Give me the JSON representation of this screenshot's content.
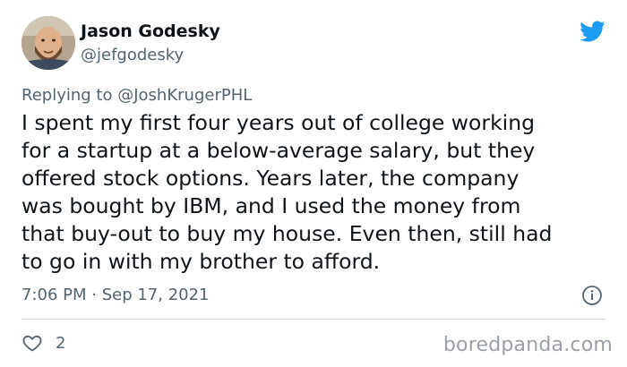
{
  "tweet": {
    "author_name": "Jason Godesky",
    "author_handle": "@jefgodesky",
    "replying_prefix": "Replying to",
    "replying_to": "@JoshKrugerPHL",
    "body_lines": [
      "I spent my first four years out of college working",
      "for a startup at a below-average salary, but they",
      "offered stock options. Years later, the company",
      "was bought by IBM, and I used the money from",
      "that buy-out to buy my house. Even then, still had",
      "to go in with my brother to afford."
    ],
    "timestamp": "7:06 PM · Sep 17, 2021",
    "like_count": "2"
  },
  "watermark": "boredpanda.com",
  "icons": {
    "brand": "twitter-bird-icon",
    "info": "info-icon",
    "like": "heart-icon"
  },
  "colors": {
    "twitter_blue": "#1d9bf0",
    "secondary_text": "#536471",
    "primary_text": "#0f1419",
    "divider": "#cfd9de"
  }
}
